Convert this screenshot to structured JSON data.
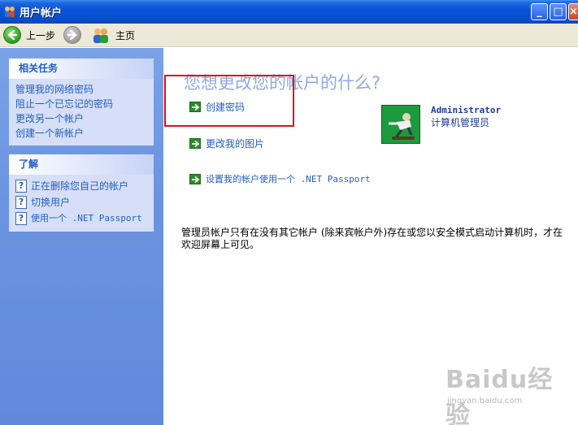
{
  "window": {
    "title": "用户帐户",
    "min_glyph": "_",
    "max_glyph": "□",
    "close_glyph": "×"
  },
  "toolbar": {
    "back_label": "上一步",
    "home_label": "主页"
  },
  "sidebar": {
    "related_tasks": {
      "title": "相关任务",
      "items": [
        {
          "label": "管理我的网络密码"
        },
        {
          "label": "阻止一个已忘记的密码"
        },
        {
          "label": "更改另一个帐户"
        },
        {
          "label": "创建一个新帐户"
        }
      ]
    },
    "learn": {
      "title": "了解",
      "items": [
        {
          "label": "正在删除您自己的帐户"
        },
        {
          "label": "切换用户"
        },
        {
          "label": "使用一个 .NET Passport"
        }
      ]
    }
  },
  "main": {
    "heading": "您想更改您的帐户的什么?",
    "tasks": [
      {
        "label": "创建密码"
      },
      {
        "label": "更改我的图片"
      },
      {
        "label": "设置我的帐户使用一个 .NET Passport"
      }
    ],
    "user": {
      "name": "Administrator",
      "role": "计算机管理员"
    },
    "note": "管理员帐户只有在没有其它帐户 (除来宾帐户外)存在或您以安全模式启动计算机时，才在欢迎屏幕上可见。"
  },
  "watermark": {
    "brand": "Baidu经验",
    "url": "jingyan.baidu.com"
  },
  "colors": {
    "link": "#215dc6",
    "heading": "#8ea9e4",
    "titlebar": "#0a54d8",
    "sidebar_bg": "#6b94e0",
    "highlight": "#e01010"
  }
}
